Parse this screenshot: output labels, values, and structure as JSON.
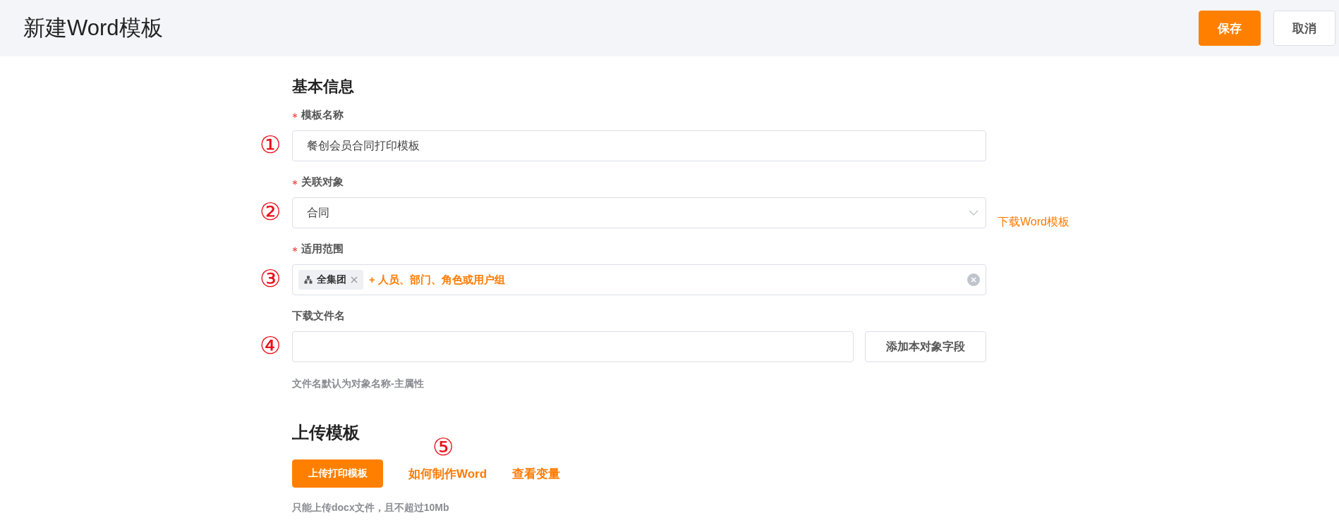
{
  "header": {
    "title": "新建Word模板",
    "buttons": [
      {
        "label": "保存",
        "kind": "primary"
      },
      {
        "label": "取消",
        "kind": "default"
      }
    ]
  },
  "basic_section": {
    "title": "基本信息",
    "fields": [
      {
        "kind": "text",
        "label": "模板名称",
        "required": true,
        "marker": "①",
        "value": "餐创会员合同打印模板"
      },
      {
        "kind": "select",
        "label": "关联对象",
        "required": true,
        "marker": "②",
        "value": "合同",
        "side_link": "下载Word模板"
      },
      {
        "kind": "scope",
        "label": "适用范围",
        "required": true,
        "marker": "③",
        "tags": [
          {
            "label": "全集团"
          }
        ],
        "add_link": "+ 人员、部门、角色或用户组"
      },
      {
        "kind": "text_button",
        "label": "下载文件名",
        "required": false,
        "marker": "④",
        "button": "添加本对象字段",
        "hint": "文件名默认为对象名称-主属性"
      }
    ]
  },
  "upload_section": {
    "title": "上传模板",
    "button": "上传打印模板",
    "links": [
      {
        "label": "如何制作Word",
        "marker": "⑤"
      },
      {
        "label": "查看变量"
      }
    ],
    "hint": "只能上传docx文件，且不超过10Mb"
  }
}
